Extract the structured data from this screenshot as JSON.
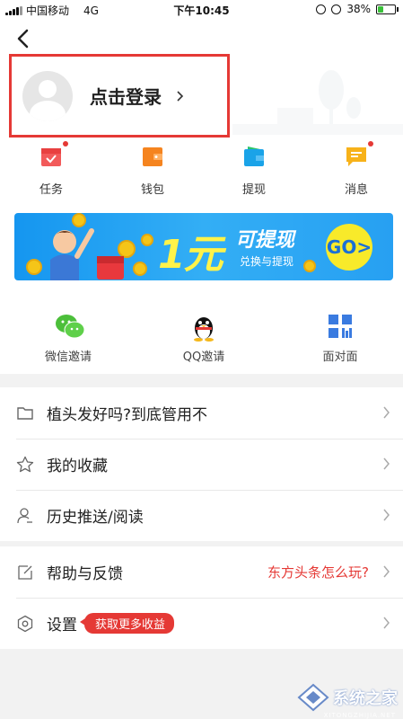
{
  "status_bar": {
    "carrier": "中国移动",
    "network": "4G",
    "time": "下午10:45",
    "battery": "38%",
    "battery_level": 0.38
  },
  "header": {
    "login_text": "点击登录"
  },
  "quick_actions": [
    {
      "label": "任务",
      "icon": "task-icon",
      "badge": true
    },
    {
      "label": "钱包",
      "icon": "wallet-icon",
      "badge": false
    },
    {
      "label": "提现",
      "icon": "withdraw-icon",
      "badge": false
    },
    {
      "label": "消息",
      "icon": "message-icon",
      "badge": true
    }
  ],
  "banner": {
    "amount": "1元",
    "title": "可提现",
    "subtitle": "兑换与提现",
    "go": "GO>"
  },
  "invites": [
    {
      "label": "微信邀请",
      "icon": "wechat-icon"
    },
    {
      "label": "QQ邀请",
      "icon": "qq-icon"
    },
    {
      "label": "面对面",
      "icon": "qr-grid-icon"
    }
  ],
  "list1": [
    {
      "label": "植头发好吗?到底管用不",
      "icon": "folder-icon"
    },
    {
      "label": "我的收藏",
      "icon": "star-icon"
    },
    {
      "label": "历史推送/阅读",
      "icon": "person-history-icon"
    }
  ],
  "list2": [
    {
      "label": "帮助与反馈",
      "icon": "edit-icon",
      "hint": "东方头条怎么玩?"
    },
    {
      "label": "设置",
      "icon": "hexagon-settings-icon",
      "tag": "获取更多收益"
    }
  ],
  "watermark": {
    "text": "系统之家",
    "sub": "XITONGZHIJIA.NET"
  },
  "colors": {
    "accent_red": "#e53935",
    "banner_blue": "#1596f0",
    "banner_yellow": "#fff34a"
  }
}
